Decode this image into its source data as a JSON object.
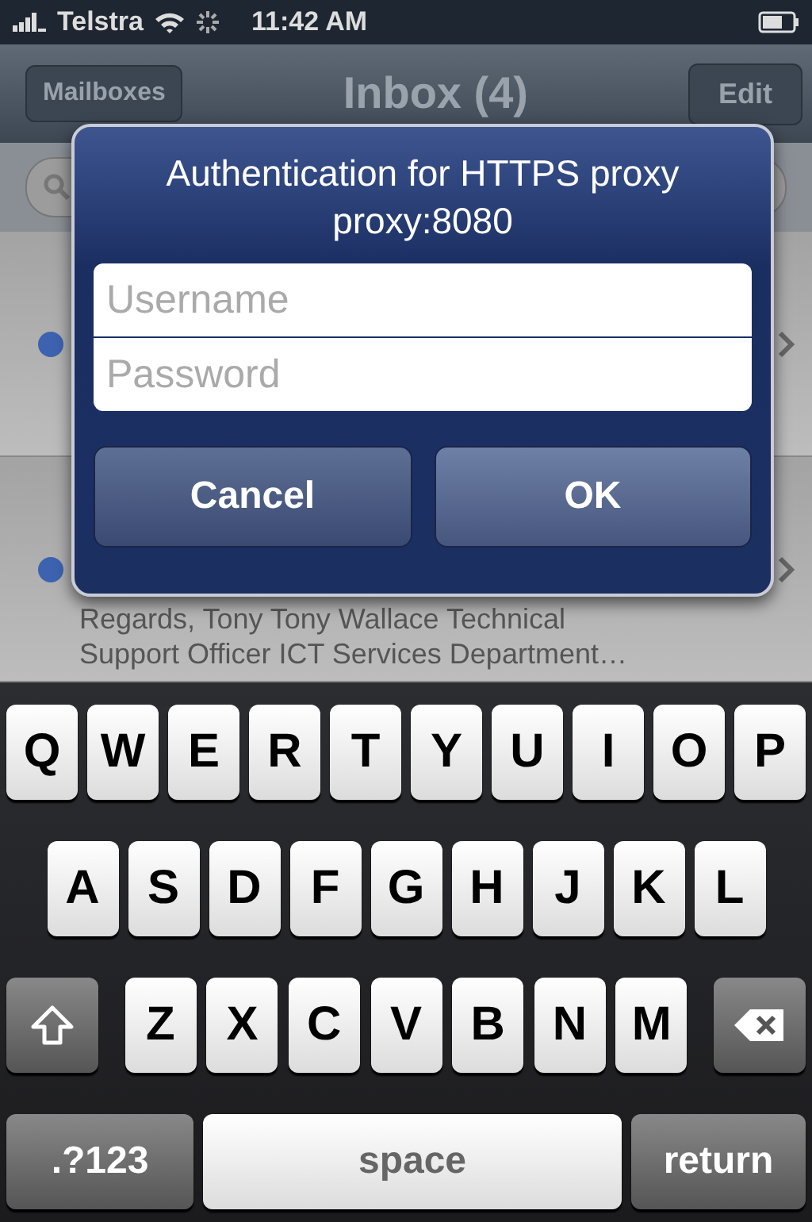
{
  "status_bar": {
    "carrier": "Telstra",
    "time": "11:42 AM"
  },
  "nav_bar": {
    "back": "Mailboxes",
    "title": "Inbox (4)",
    "action": "Edit"
  },
  "messages": [
    {
      "unread": true
    },
    {
      "unread": true,
      "preview_lines": [
        "Regards, Tony Tony Wallace Technical",
        "Support Officer ICT Services Department…"
      ]
    }
  ],
  "dialog": {
    "title": "Authentication for HTTPS proxy",
    "subtitle": "proxy:8080",
    "fields": [
      {
        "placeholder": "Username"
      },
      {
        "placeholder": "Password"
      }
    ],
    "buttons": [
      {
        "label": "Cancel",
        "kind": "cancel"
      },
      {
        "label": "OK",
        "kind": "default"
      }
    ]
  },
  "keyboard": {
    "letter_rows": [
      [
        {
          "kind": "letter",
          "label": "Q"
        },
        {
          "kind": "letter",
          "label": "W"
        },
        {
          "kind": "letter",
          "label": "E"
        },
        {
          "kind": "letter",
          "label": "R"
        },
        {
          "kind": "letter",
          "label": "T"
        },
        {
          "kind": "letter",
          "label": "Y"
        },
        {
          "kind": "letter",
          "label": "U"
        },
        {
          "kind": "letter",
          "label": "I"
        },
        {
          "kind": "letter",
          "label": "O"
        },
        {
          "kind": "letter",
          "label": "P"
        }
      ],
      [
        {
          "kind": "letter",
          "label": "A"
        },
        {
          "kind": "letter",
          "label": "S"
        },
        {
          "kind": "letter",
          "label": "D"
        },
        {
          "kind": "letter",
          "label": "F"
        },
        {
          "kind": "letter",
          "label": "G"
        },
        {
          "kind": "letter",
          "label": "H"
        },
        {
          "kind": "letter",
          "label": "J"
        },
        {
          "kind": "letter",
          "label": "K"
        },
        {
          "kind": "letter",
          "label": "L"
        }
      ],
      [
        {
          "kind": "shift"
        },
        {
          "kind": "letter",
          "label": "Z"
        },
        {
          "kind": "letter",
          "label": "X"
        },
        {
          "kind": "letter",
          "label": "C"
        },
        {
          "kind": "letter",
          "label": "V"
        },
        {
          "kind": "letter",
          "label": "B"
        },
        {
          "kind": "letter",
          "label": "N"
        },
        {
          "kind": "letter",
          "label": "M"
        },
        {
          "kind": "delete"
        }
      ]
    ],
    "bottom_row": [
      {
        "kind": "mode",
        "label": ".?123"
      },
      {
        "kind": "space",
        "label": "space"
      },
      {
        "kind": "return",
        "label": "return"
      }
    ]
  }
}
